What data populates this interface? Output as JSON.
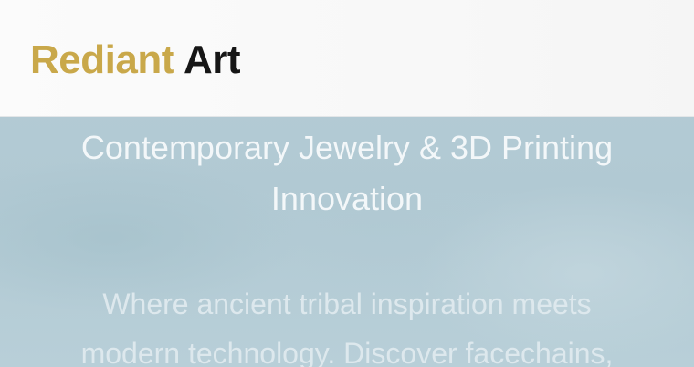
{
  "header": {
    "brand_accent": "Rediant",
    "brand_main": "Art"
  },
  "hero": {
    "headline_line1": "Contemporary Jewelry & 3D Printing",
    "headline_line2": "Innovation",
    "tagline_line1": "Where ancient tribal inspiration meets",
    "tagline_line2": "modern technology. Discover facechains,"
  },
  "colors": {
    "brand_gold": "#c9a84a",
    "brand_dark": "#161616",
    "hero_background": "#b3ccd6",
    "navbar_background": "#f8f8f8"
  }
}
